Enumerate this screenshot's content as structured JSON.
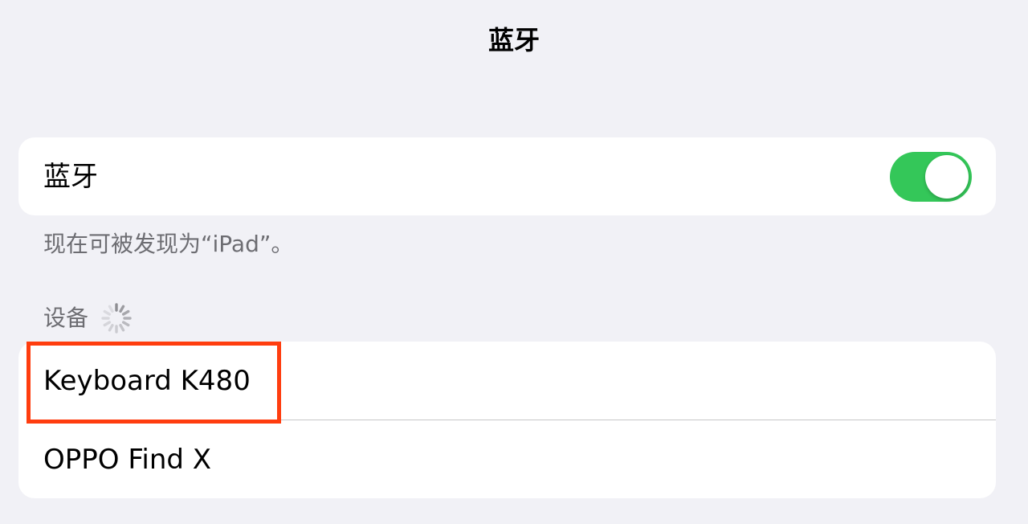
{
  "header": {
    "title": "蓝牙"
  },
  "bluetooth_toggle": {
    "label": "蓝牙",
    "state": "on",
    "on_color": "#34c759"
  },
  "discoverable_note": "现在可被发现为“iPad”。",
  "devices_section": {
    "header": "设备",
    "loading_icon": "activity-spinner-icon",
    "items": [
      {
        "label": "Keyboard K480",
        "highlighted": true
      },
      {
        "label": "OPPO Find X",
        "highlighted": false
      }
    ]
  },
  "colors": {
    "background": "#f1f1f6",
    "card": "#ffffff",
    "secondary_text": "#6d6d72",
    "highlight": "#ff3d0f"
  }
}
